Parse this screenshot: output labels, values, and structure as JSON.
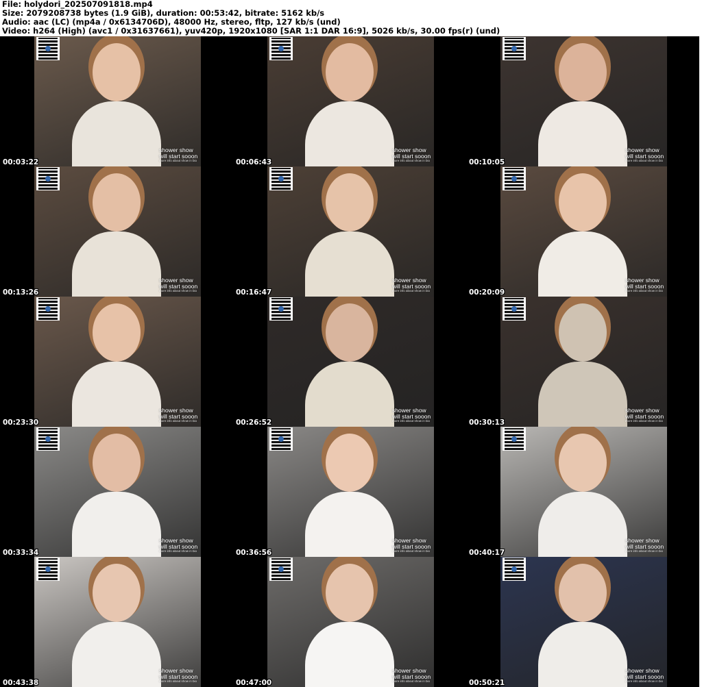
{
  "header": {
    "line1": "File: holydori_202507091818.mp4",
    "line2": "Size: 2079208738 bytes (1.9 GiB), duration: 00:53:42, bitrate: 5162 kb/s",
    "line3": "Audio: aac (LC) (mp4a / 0x6134706D), 48000 Hz, stereo, fltp, 127 kb/s (und)",
    "line4": "Video: h264 (High) (avc1 / 0x31637661), yuv420p, 1920x1080 [SAR 1:1 DAR 16:9], 5026 kb/s, 30.00 fps(r) (und)"
  },
  "overlay": {
    "promo_line1": "shower show",
    "promo_line2": "will start sooon",
    "promo_line3": "more info about show in bio"
  },
  "thumbnails": [
    {
      "time": "00:03:22",
      "bg": "#6b5a4c",
      "skin": "#e6c1a6",
      "shirt": "#e9e4dc"
    },
    {
      "time": "00:06:43",
      "bg": "#4a3d34",
      "skin": "#e3bba1",
      "shirt": "#ece7e0"
    },
    {
      "time": "00:10:05",
      "bg": "#3d3430",
      "skin": "#dcb39a",
      "shirt": "#eee9e3"
    },
    {
      "time": "00:13:26",
      "bg": "#5c4c40",
      "skin": "#e4bfa5",
      "shirt": "#e8e2d8"
    },
    {
      "time": "00:16:47",
      "bg": "#4d4036",
      "skin": "#e6c3a9",
      "shirt": "#e6dfd2"
    },
    {
      "time": "00:20:09",
      "bg": "#5a4a3f",
      "skin": "#e8c4aa",
      "shirt": "#f0ece6"
    },
    {
      "time": "00:23:30",
      "bg": "#6a584b",
      "skin": "#e7c2a8",
      "shirt": "#ebe6df"
    },
    {
      "time": "00:26:52",
      "bg": "#2f2a28",
      "skin": "#d9b59e",
      "shirt": "#e3dccd"
    },
    {
      "time": "00:30:13",
      "bg": "#3a312d",
      "skin": "#cfc2b2",
      "shirt": "#cfc6b8"
    },
    {
      "time": "00:33:34",
      "bg": "#8b8a88",
      "skin": "#e3bda5",
      "shirt": "#f1efec"
    },
    {
      "time": "00:36:56",
      "bg": "#8a8886",
      "skin": "#ecc9b2",
      "shirt": "#f4f2ef"
    },
    {
      "time": "00:40:17",
      "bg": "#b9b7b4",
      "skin": "#e8c7b0",
      "shirt": "#efedea"
    },
    {
      "time": "00:43:38",
      "bg": "#cbc7c3",
      "skin": "#e7c6b0",
      "shirt": "#f1efec"
    },
    {
      "time": "00:47:00",
      "bg": "#6e6c6a",
      "skin": "#e6c4ad",
      "shirt": "#f6f5f3"
    },
    {
      "time": "00:50:21",
      "bg": "#2c3550",
      "skin": "#e2c1ab",
      "shirt": "#efede9"
    }
  ]
}
